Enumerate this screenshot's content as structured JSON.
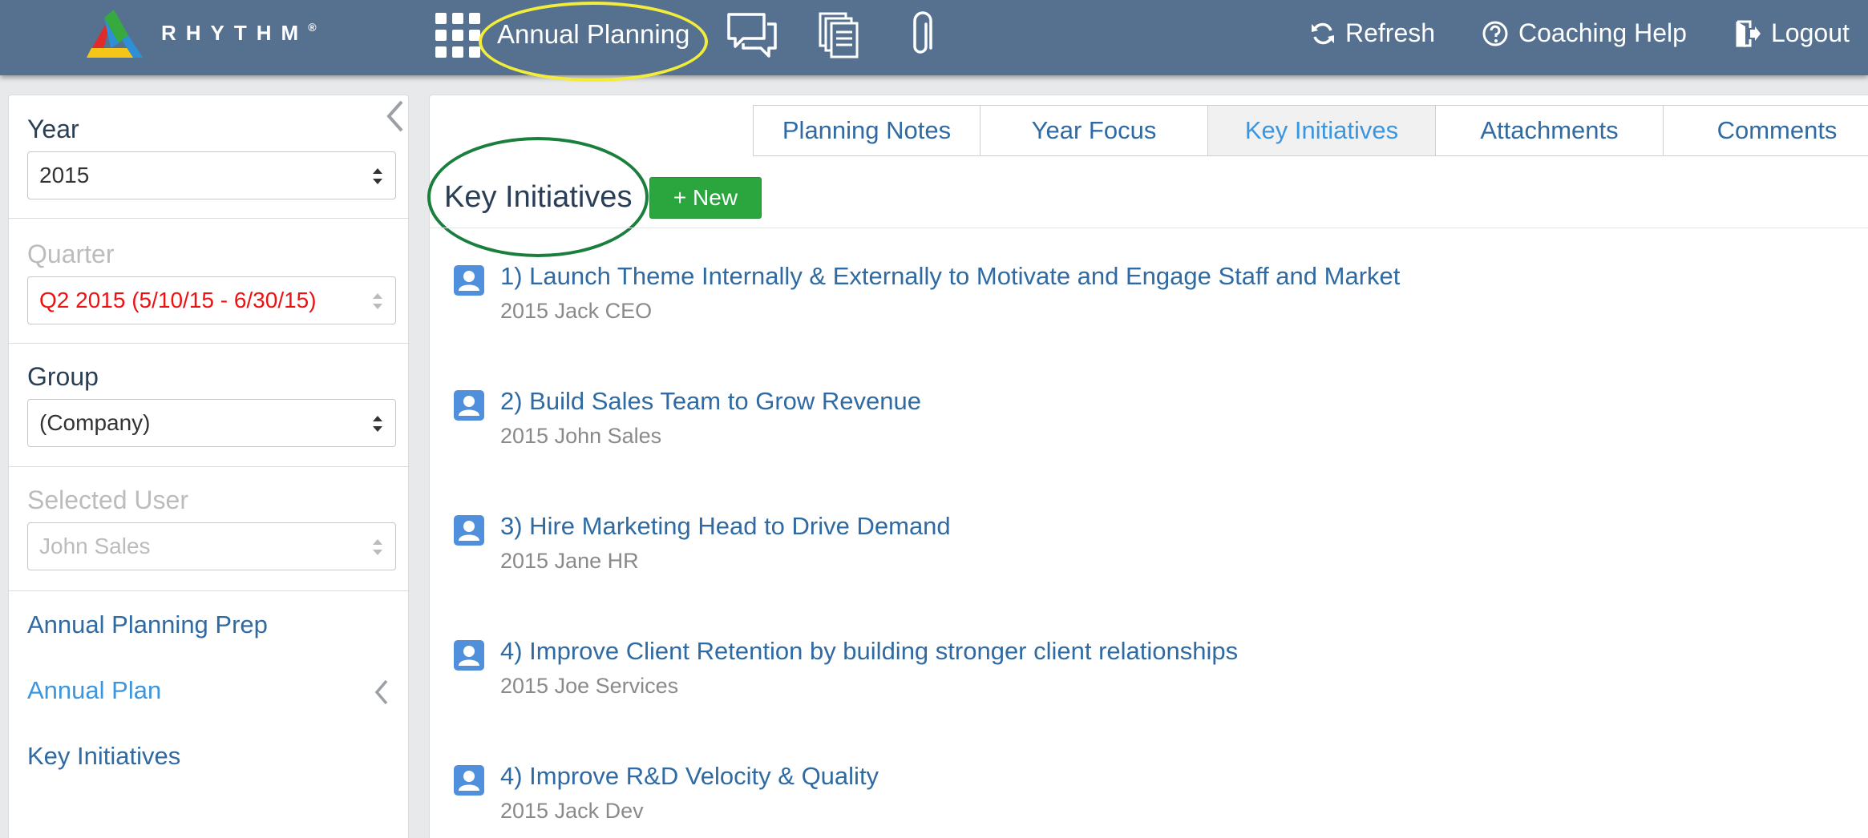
{
  "brand": {
    "name": "RHYTHM",
    "reg": "®"
  },
  "header": {
    "module_title": "Annual Planning",
    "refresh_label": "Refresh",
    "help_label": "Coaching Help",
    "logout_label": "Logout",
    "bar_color": "#56708f"
  },
  "sidebar": {
    "year_label": "Year",
    "year_value": "2015",
    "quarter_label": "Quarter",
    "quarter_value": "Q2 2015 (5/10/15 - 6/30/15)",
    "group_label": "Group",
    "group_value": "(Company)",
    "user_label": "Selected User",
    "user_value": "John Sales",
    "links": [
      {
        "label": "Annual Planning Prep"
      },
      {
        "label": "Annual Plan"
      },
      {
        "label": "Key Initiatives"
      }
    ]
  },
  "tabs": [
    {
      "label": "Planning Notes"
    },
    {
      "label": "Year Focus"
    },
    {
      "label": "Key Initiatives"
    },
    {
      "label": "Attachments"
    },
    {
      "label": "Comments"
    }
  ],
  "main": {
    "section_title": "Key Initiatives",
    "new_button_label": "+ New",
    "items": [
      {
        "title": "1) Launch Theme Internally & Externally to Motivate and Engage Staff and Market",
        "meta": "2015 Jack CEO"
      },
      {
        "title": "2) Build Sales Team to Grow Revenue",
        "meta": "2015 John Sales"
      },
      {
        "title": "3) Hire Marketing Head to Drive Demand",
        "meta": "2015 Jane HR"
      },
      {
        "title": "4) Improve Client Retention by building stronger client relationships",
        "meta": "2015 Joe Services"
      },
      {
        "title": "4) Improve R&D Velocity & Quality",
        "meta": "2015 Jack Dev"
      }
    ]
  },
  "colors": {
    "link": "#2f6aa3",
    "active_link": "#3b96e0",
    "new_button": "#2ba63f",
    "quarter_text": "#ee1111",
    "highlight_yellow": "#f2ed3c",
    "highlight_green": "#1a7f3c"
  }
}
